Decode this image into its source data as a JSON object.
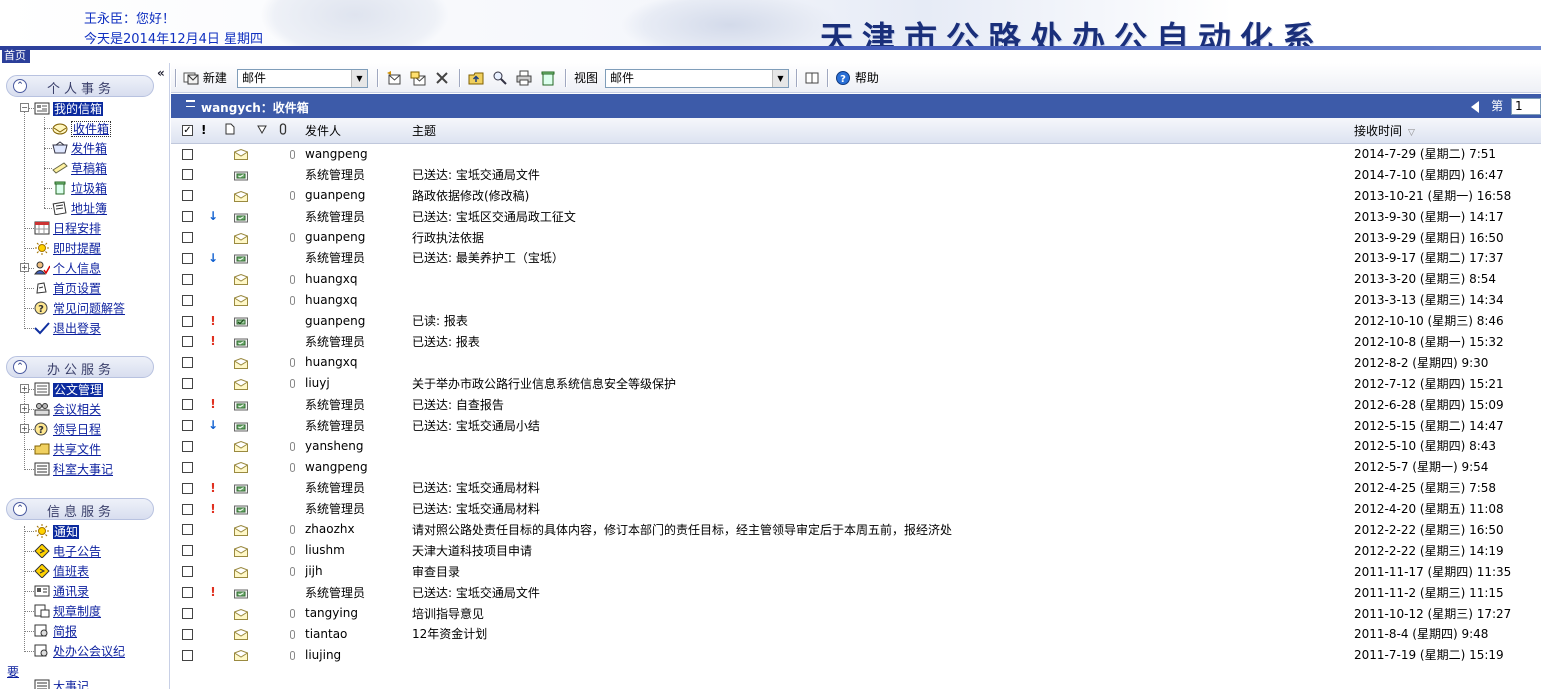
{
  "header": {
    "greeting": "王永臣：您好！",
    "date_line": "今天是2014年12月4日 星期四",
    "system_title": "天津市公路处办公自动化系",
    "home_link": "首页"
  },
  "sidebar": {
    "collapse_label": "«",
    "sections": [
      {
        "title": "个人事务",
        "items": [
          {
            "label": "我的信箱",
            "icon": "mailbox-icon",
            "expander": "−"
          },
          {
            "label": "收件箱",
            "icon": "inbox-icon",
            "level": 2
          },
          {
            "label": "发件箱",
            "icon": "outbox-icon",
            "level": 2
          },
          {
            "label": "草稿箱",
            "icon": "drafts-icon",
            "level": 2
          },
          {
            "label": "垃圾箱",
            "icon": "trash-icon",
            "level": 2
          },
          {
            "label": "地址簿",
            "icon": "address-book-icon",
            "level": 2
          },
          {
            "label": "日程安排",
            "icon": "calendar-icon"
          },
          {
            "label": "即时提醒",
            "icon": "alert-icon"
          },
          {
            "label": "个人信息",
            "icon": "user-icon",
            "expander": "+"
          },
          {
            "label": "首页设置",
            "icon": "home-settings-icon"
          },
          {
            "label": "常见问题解答",
            "icon": "faq-icon"
          },
          {
            "label": "退出登录",
            "icon": "logout-check-icon"
          }
        ]
      },
      {
        "title": "办公服务",
        "items": [
          {
            "label": "公文管理",
            "icon": "document-icon",
            "expander": "+"
          },
          {
            "label": "会议相关",
            "icon": "meeting-icon",
            "expander": "+"
          },
          {
            "label": "领导日程",
            "icon": "leader-schedule-icon",
            "expander": "+"
          },
          {
            "label": "共享文件",
            "icon": "shared-folder-icon"
          },
          {
            "label": "科室大事记",
            "icon": "notebook-icon"
          }
        ]
      },
      {
        "title": "信息服务",
        "items": [
          {
            "label": "通知",
            "icon": "notice-icon"
          },
          {
            "label": "电子公告",
            "icon": "bulletin-icon"
          },
          {
            "label": "值班表",
            "icon": "duty-icon"
          },
          {
            "label": "通讯录",
            "icon": "contacts-icon"
          },
          {
            "label": "规章制度",
            "icon": "rules-icon"
          },
          {
            "label": "简报",
            "icon": "brief-icon"
          },
          {
            "label": "处办公会议纪",
            "icon": "minutes-icon"
          }
        ]
      }
    ],
    "bottom_char": "要",
    "bottom_item": "大事记"
  },
  "toolbar": {
    "new_label": "新建",
    "new_select_value": "邮件",
    "view_label": "视图",
    "view_select_value": "邮件",
    "help_label": "帮助"
  },
  "folder": {
    "title": "wangych：收件箱",
    "page_label": "第",
    "page_value": "1"
  },
  "columns": {
    "sender": "发件人",
    "subject": "主题",
    "received": "接收时间",
    "importance": "!"
  },
  "colors": {
    "accent": "#3d5ba9",
    "title_blue": "#1a2f7a",
    "link_blue": "#0b1f9e",
    "important_red": "#e03020",
    "low_blue": "#1060d0"
  },
  "messages": [
    {
      "flag": "",
      "type": "open",
      "attach": true,
      "sender": "wangpeng",
      "subject": "",
      "received": "2014-7-29 (星期二) 7:51"
    },
    {
      "flag": "",
      "type": "receipt",
      "attach": false,
      "sender": "系统管理员",
      "subject": "已送达: 宝坻交通局文件",
      "received": "2014-7-10 (星期四) 16:47"
    },
    {
      "flag": "",
      "type": "open",
      "attach": true,
      "sender": "guanpeng",
      "subject": "路政依据修改(修改稿)",
      "received": "2013-10-21 (星期一) 16:58"
    },
    {
      "flag": "low",
      "type": "receipt",
      "attach": false,
      "sender": "系统管理员",
      "subject": "已送达: 宝坻区交通局政工征文",
      "received": "2013-9-30 (星期一) 14:17"
    },
    {
      "flag": "",
      "type": "open",
      "attach": true,
      "sender": "guanpeng",
      "subject": "行政执法依据",
      "received": "2013-9-29 (星期日) 16:50"
    },
    {
      "flag": "low",
      "type": "receipt",
      "attach": false,
      "sender": "系统管理员",
      "subject": "已送达: 最美养护工（宝坻）",
      "received": "2013-9-17 (星期二) 17:37"
    },
    {
      "flag": "",
      "type": "open",
      "attach": true,
      "sender": "huangxq",
      "subject": "",
      "received": "2013-3-20 (星期三) 8:54"
    },
    {
      "flag": "",
      "type": "open",
      "attach": true,
      "sender": "huangxq",
      "subject": "",
      "received": "2013-3-13 (星期三) 14:34"
    },
    {
      "flag": "high",
      "type": "read-receipt",
      "attach": false,
      "sender": "guanpeng",
      "subject": "已读: 报表",
      "received": "2012-10-10 (星期三) 8:46"
    },
    {
      "flag": "high",
      "type": "receipt",
      "attach": false,
      "sender": "系统管理员",
      "subject": "已送达: 报表",
      "received": "2012-10-8 (星期一) 15:32"
    },
    {
      "flag": "",
      "type": "open",
      "attach": true,
      "sender": "huangxq",
      "subject": "",
      "received": "2012-8-2 (星期四) 9:30"
    },
    {
      "flag": "",
      "type": "open",
      "attach": true,
      "sender": "liuyj",
      "subject": "关于举办市政公路行业信息系统信息安全等级保护",
      "received": "2012-7-12 (星期四) 15:21"
    },
    {
      "flag": "high",
      "type": "receipt",
      "attach": false,
      "sender": "系统管理员",
      "subject": "已送达: 自查报告",
      "received": "2012-6-28 (星期四) 15:09"
    },
    {
      "flag": "low",
      "type": "receipt",
      "attach": false,
      "sender": "系统管理员",
      "subject": "已送达: 宝坻交通局小结",
      "received": "2012-5-15 (星期二) 14:47"
    },
    {
      "flag": "",
      "type": "open",
      "attach": true,
      "sender": "yansheng",
      "subject": "",
      "received": "2012-5-10 (星期四) 8:43"
    },
    {
      "flag": "",
      "type": "open",
      "attach": true,
      "sender": "wangpeng",
      "subject": "",
      "received": "2012-5-7 (星期一) 9:54"
    },
    {
      "flag": "high",
      "type": "receipt",
      "attach": false,
      "sender": "系统管理员",
      "subject": "已送达: 宝坻交通局材料",
      "received": "2012-4-25 (星期三) 7:58"
    },
    {
      "flag": "high",
      "type": "receipt",
      "attach": false,
      "sender": "系统管理员",
      "subject": "已送达: 宝坻交通局材料",
      "received": "2012-4-20 (星期五) 11:08"
    },
    {
      "flag": "",
      "type": "open",
      "attach": true,
      "sender": "zhaozhx",
      "subject": "请对照公路处责任目标的具体内容，修订本部门的责任目标，经主管领导审定后于本周五前，报经济处",
      "received": "2012-2-22 (星期三) 16:50"
    },
    {
      "flag": "",
      "type": "open",
      "attach": true,
      "sender": "liushm",
      "subject": "天津大道科技项目申请",
      "received": "2012-2-22 (星期三) 14:19"
    },
    {
      "flag": "",
      "type": "open",
      "attach": true,
      "sender": "jijh",
      "subject": "审查目录",
      "received": "2011-11-17 (星期四) 11:35"
    },
    {
      "flag": "high",
      "type": "receipt",
      "attach": false,
      "sender": "系统管理员",
      "subject": "已送达: 宝坻交通局文件",
      "received": "2011-11-2 (星期三) 11:15"
    },
    {
      "flag": "",
      "type": "open",
      "attach": true,
      "sender": "tangying",
      "subject": "培训指导意见",
      "received": "2011-10-12 (星期三) 17:27"
    },
    {
      "flag": "",
      "type": "open",
      "attach": true,
      "sender": "tiantao",
      "subject": "12年资金计划",
      "received": "2011-8-4 (星期四) 9:48"
    },
    {
      "flag": "",
      "type": "open",
      "attach": true,
      "sender": "liujing",
      "subject": "",
      "received": "2011-7-19 (星期二) 15:19"
    }
  ]
}
